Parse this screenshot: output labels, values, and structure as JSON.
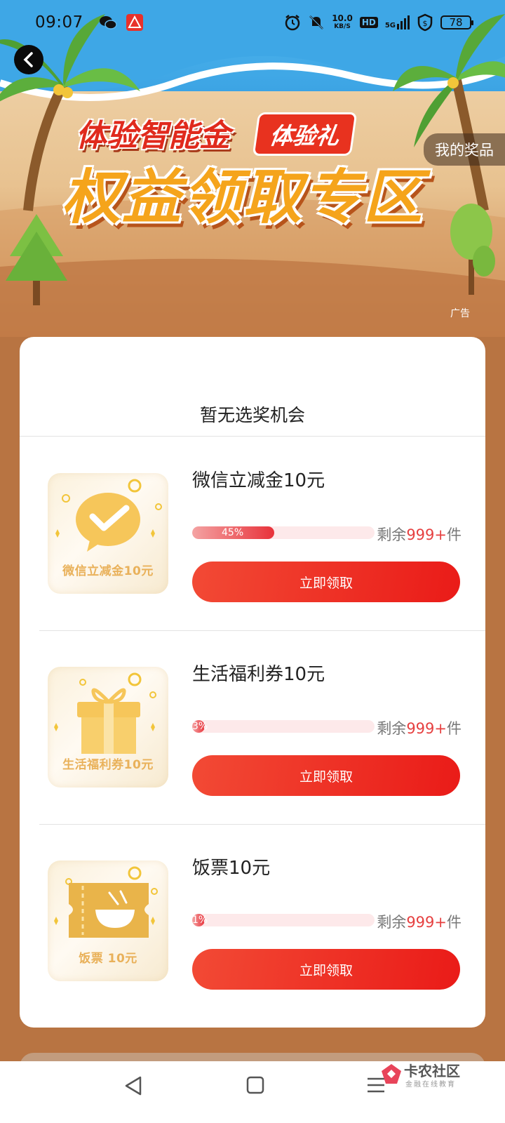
{
  "status_bar": {
    "time": "09:07",
    "net_speed_value": "10.0",
    "net_speed_unit": "KB/S",
    "hd_label": "HD",
    "signal_label": "5G",
    "battery": "78"
  },
  "banner": {
    "subtitle": "体验智能金",
    "badge": "体验礼",
    "title": "权益领取专区",
    "my_prizes": "我的奖品",
    "ad_label": "广告"
  },
  "card": {
    "no_chance_text": "暂无选奖机会",
    "prizes": [
      {
        "name": "微信立减金10元",
        "thumb_label": "微信立减金10元",
        "icon": "wechat-icon",
        "progress_percent": 45,
        "progress_label": "45%",
        "remaining_prefix": "剩余",
        "remaining_count": "999+",
        "remaining_suffix": "件",
        "claim_label": "立即领取"
      },
      {
        "name": "生活福利券10元",
        "thumb_label": "生活福利券10元",
        "icon": "gift-icon",
        "progress_percent": 3,
        "progress_label": "3%",
        "remaining_prefix": "剩余",
        "remaining_count": "999+",
        "remaining_suffix": "件",
        "claim_label": "立即领取"
      },
      {
        "name": "饭票10元",
        "thumb_label": "饭票 10元",
        "icon": "meal-ticket-icon",
        "progress_percent": 1,
        "progress_label": "1%",
        "remaining_prefix": "剩余",
        "remaining_count": "999+",
        "remaining_suffix": "件",
        "claim_label": "立即领取"
      }
    ]
  },
  "watermark": {
    "title": "卡农社区",
    "subtitle": "金融在线教育"
  },
  "colors": {
    "page_bg": "#b87442",
    "accent_red": "#ea1b18",
    "progress_track": "#fde9ea",
    "count_red": "#e64040"
  }
}
